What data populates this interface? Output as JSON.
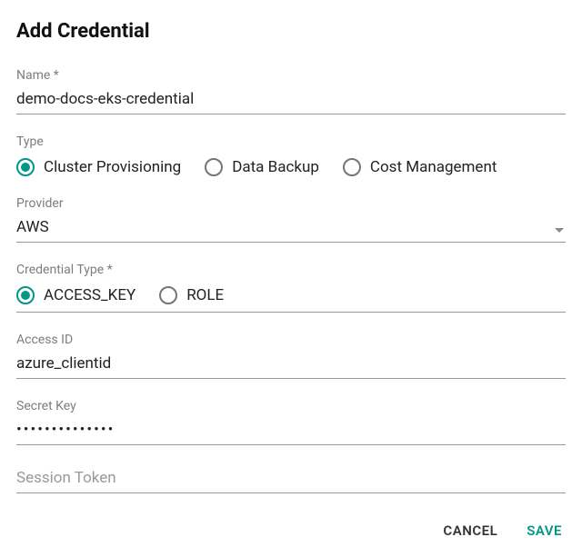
{
  "dialog": {
    "title": "Add Credential"
  },
  "fields": {
    "name": {
      "label": "Name *",
      "value": "demo-docs-eks-credential"
    },
    "type": {
      "label": "Type",
      "options": [
        "Cluster Provisioning",
        "Data Backup",
        "Cost Management"
      ],
      "selected": "Cluster Provisioning"
    },
    "provider": {
      "label": "Provider",
      "value": "AWS"
    },
    "credential_type": {
      "label": "Credential Type *",
      "options": [
        "ACCESS_KEY",
        "ROLE"
      ],
      "selected": "ACCESS_KEY"
    },
    "access_id": {
      "label": "Access ID",
      "value": "azure_clientid"
    },
    "secret_key": {
      "label": "Secret Key",
      "value": "••••••••••••••"
    },
    "session_token": {
      "label": "Session Token",
      "value": ""
    }
  },
  "actions": {
    "cancel": "CANCEL",
    "save": "SAVE"
  }
}
